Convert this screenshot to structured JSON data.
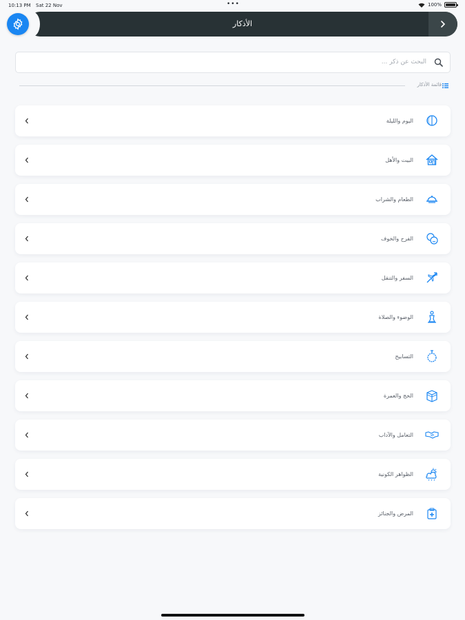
{
  "status_bar": {
    "time": "10:13 PM",
    "date": "Sat 22 Nov",
    "dots": "•••",
    "battery": "100%"
  },
  "header": {
    "title": "الأذكار",
    "back_icon": "chevron-right-icon",
    "settings_icon": "gear-icon"
  },
  "search": {
    "placeholder": "البحث عن ذكر ..."
  },
  "section": {
    "title": "قائمة الأذكار",
    "icon": "list-icon"
  },
  "categories": [
    {
      "label": "اليوم والليلة",
      "icon": "day-night-icon"
    },
    {
      "label": "البيت والأهل",
      "icon": "house-icon"
    },
    {
      "label": "الطعام والشراب",
      "icon": "food-dish-icon"
    },
    {
      "label": "الفرح والخوف",
      "icon": "emotions-icon"
    },
    {
      "label": "السفر والتنقل",
      "icon": "airplane-icon"
    },
    {
      "label": "الوضوء والصلاة",
      "icon": "prayer-icon"
    },
    {
      "label": "التسابيح",
      "icon": "prayer-beads-icon"
    },
    {
      "label": "الحج والعمرة",
      "icon": "kaaba-icon"
    },
    {
      "label": "التعامل والآداب",
      "icon": "handshake-icon"
    },
    {
      "label": "الظواهر الكونية",
      "icon": "weather-icon"
    },
    {
      "label": "المرض والجنائز",
      "icon": "medical-icon"
    }
  ],
  "colors": {
    "accent": "#1a86f2",
    "header_bg": "#283235",
    "background": "#f7f8fa"
  }
}
